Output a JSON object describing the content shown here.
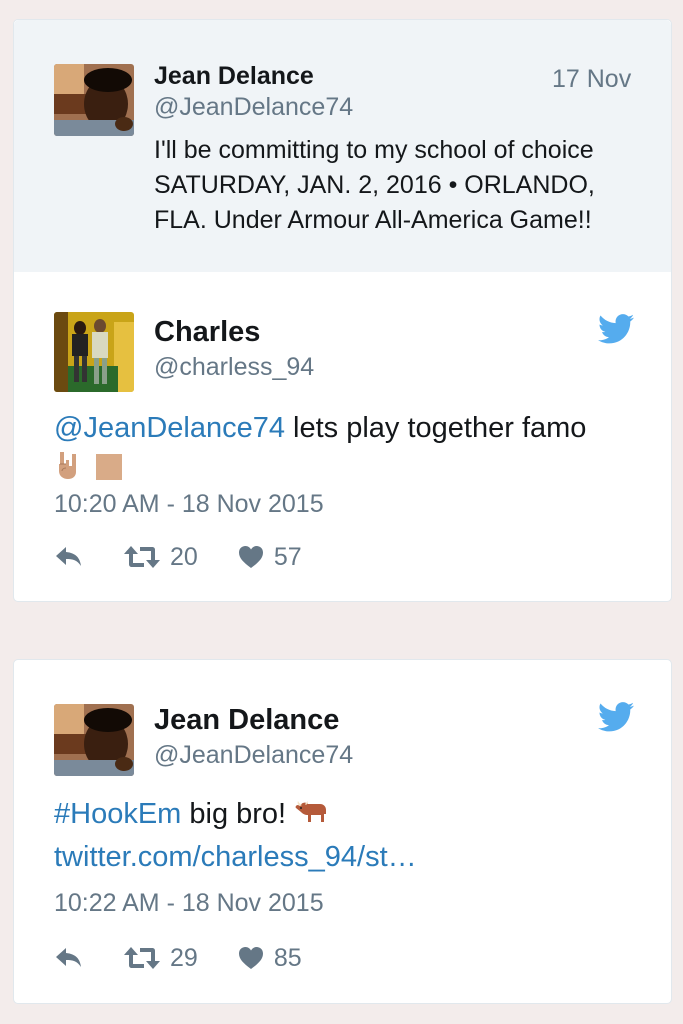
{
  "colors": {
    "background": "#f3eceb",
    "link": "#2b7bb9",
    "twitter_blue": "#55acee",
    "muted": "#657786"
  },
  "quoted_tweet": {
    "name": "Jean Delance",
    "handle": "@JeanDelance74",
    "date": "17 Nov",
    "text_lines": [
      "I'll be committing to my school of choice",
      "SATURDAY, JAN. 2, 2016 • ORLANDO,",
      "FLA. Under Armour All-America Game!!"
    ]
  },
  "tweet1": {
    "name": "Charles",
    "handle": "@charless_94",
    "mention": "@JeanDelance74",
    "text": " lets play together famo",
    "emojis": [
      "sign-of-horns-emoji",
      "skin-tone-modifier-emoji"
    ],
    "timestamp": "10:20 AM - 18 Nov 2015",
    "retweets": "20",
    "likes": "57",
    "icons": [
      "reply-icon",
      "retweet-icon",
      "heart-icon",
      "twitter-bird-icon"
    ]
  },
  "tweet2": {
    "name": "Jean Delance",
    "handle": "@JeanDelance74",
    "hashtag": "#HookEm",
    "text": " big bro! ",
    "emoji": "ox-emoji",
    "link": "twitter.com/charless_94/st…",
    "timestamp": "10:22 AM - 18 Nov 2015",
    "retweets": "29",
    "likes": "85",
    "icons": [
      "reply-icon",
      "retweet-icon",
      "heart-icon",
      "twitter-bird-icon"
    ]
  }
}
